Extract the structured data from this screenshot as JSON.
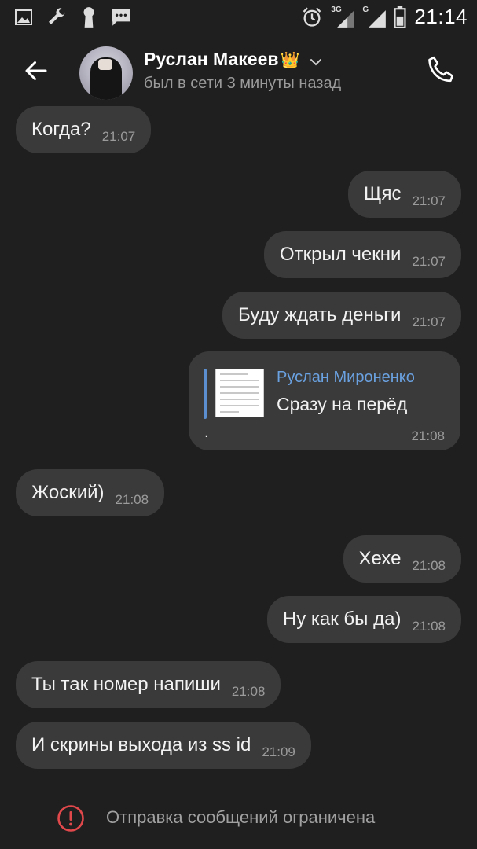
{
  "statusbar": {
    "network_3g": "3G",
    "network_g": "G",
    "time": "21:14",
    "icons": [
      "image-icon",
      "wrench-icon",
      "keyhole-icon",
      "chat-icon",
      "alarm-icon",
      "signal-icon",
      "battery-icon"
    ]
  },
  "header": {
    "name": "Руслан Макеев",
    "crown": "👑",
    "status": "был в сети 3 минуты назад"
  },
  "messages": [
    {
      "text": "Когда?",
      "time": "21:07",
      "side": "in"
    },
    {
      "text": "Щяс",
      "time": "21:07",
      "side": "out"
    },
    {
      "text": "Открыл чекни",
      "time": "21:07",
      "side": "out"
    },
    {
      "text": "Буду ждать деньги",
      "time": "21:07",
      "side": "out"
    },
    {
      "text": "Жоский)",
      "time": "21:08",
      "side": "in"
    },
    {
      "text": "Хехе",
      "time": "21:08",
      "side": "out"
    },
    {
      "text": "Ну как бы да)",
      "time": "21:08",
      "side": "out"
    },
    {
      "text": "Ты так номер напиши",
      "time": "21:08",
      "side": "in"
    },
    {
      "text": "И скрины выхода из ss id",
      "time": "21:09",
      "side": "in"
    }
  ],
  "reply_message": {
    "author": "Руслан Мироненко",
    "quoted": "Сразу на перёд",
    "text": ".",
    "time": "21:08"
  },
  "composer": {
    "restricted_text": "Отправка сообщений ограничена"
  },
  "colors": {
    "background": "#1f1f1f",
    "bubble": "#3a3a3a",
    "link_blue": "#6aa1e0",
    "warning_red": "#e0484b"
  }
}
